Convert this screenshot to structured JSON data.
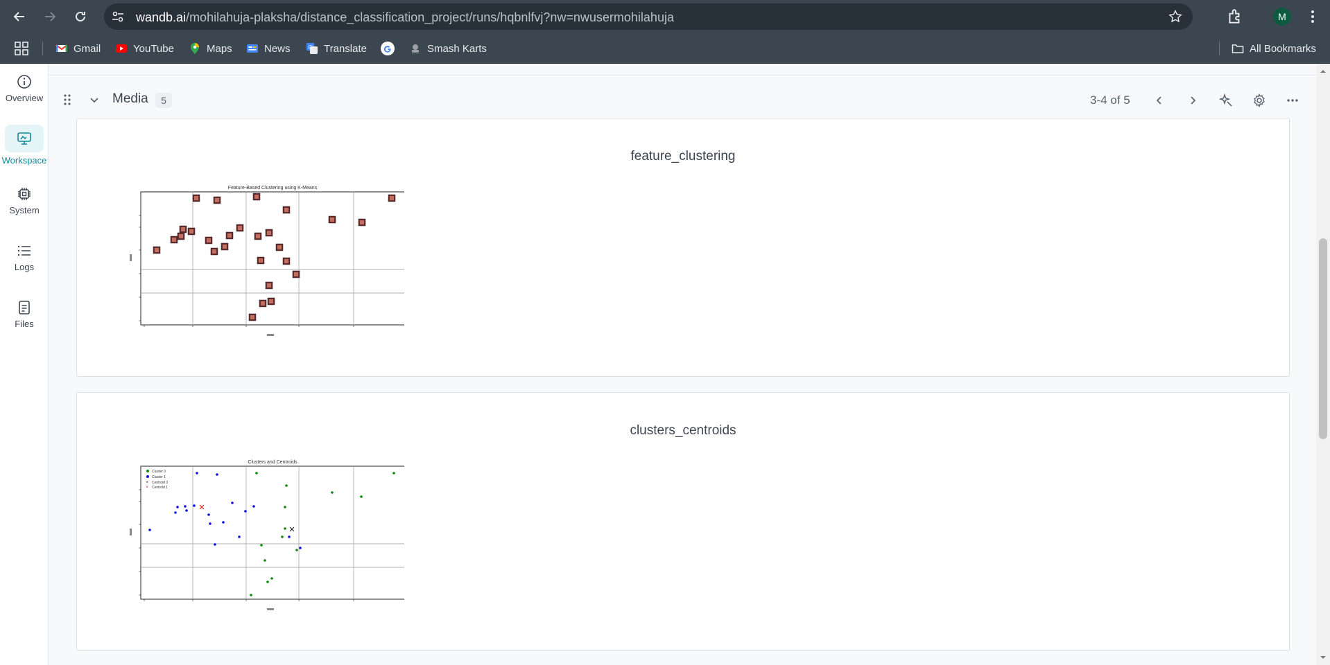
{
  "browser": {
    "url_host": "wandb.ai",
    "url_path": "/mohilahuja-plaksha/distance_classification_project/runs/hqbnlfvj?nw=nwusermohilahuja",
    "profile_initial": "M",
    "bookmarks": [
      {
        "label": "Gmail",
        "icon": "gmail-icon"
      },
      {
        "label": "YouTube",
        "icon": "youtube-icon"
      },
      {
        "label": "Maps",
        "icon": "maps-icon"
      },
      {
        "label": "News",
        "icon": "news-icon"
      },
      {
        "label": "Translate",
        "icon": "translate-icon"
      },
      {
        "label": "",
        "icon": "google-icon"
      },
      {
        "label": "Smash Karts",
        "icon": "smash-karts-icon"
      }
    ],
    "all_bookmarks": "All Bookmarks"
  },
  "rail": {
    "items": [
      {
        "label": "Overview",
        "icon": "info-icon",
        "active": false
      },
      {
        "label": "Workspace",
        "icon": "workspace-icon",
        "active": true
      },
      {
        "label": "System",
        "icon": "chip-icon",
        "active": false
      },
      {
        "label": "Logs",
        "icon": "list-icon",
        "active": false
      },
      {
        "label": "Files",
        "icon": "file-icon",
        "active": false
      }
    ]
  },
  "section": {
    "title": "Media",
    "count": "5",
    "pager": "3-4 of 5"
  },
  "panels": [
    {
      "title": "feature_clustering",
      "image_title": "Feature-Based Clustering using K-Means"
    },
    {
      "title": "clusters_centroids",
      "image_title": "Clusters and Centroids",
      "legend": [
        "Cluster 0",
        "Cluster 1",
        "Centroid 0",
        "Centroid 1"
      ]
    }
  ],
  "colors": {
    "accent": "#13899c",
    "cluster0": "#0a8a0a",
    "cluster1": "#1010e0",
    "centroid1": "#e01010"
  }
}
